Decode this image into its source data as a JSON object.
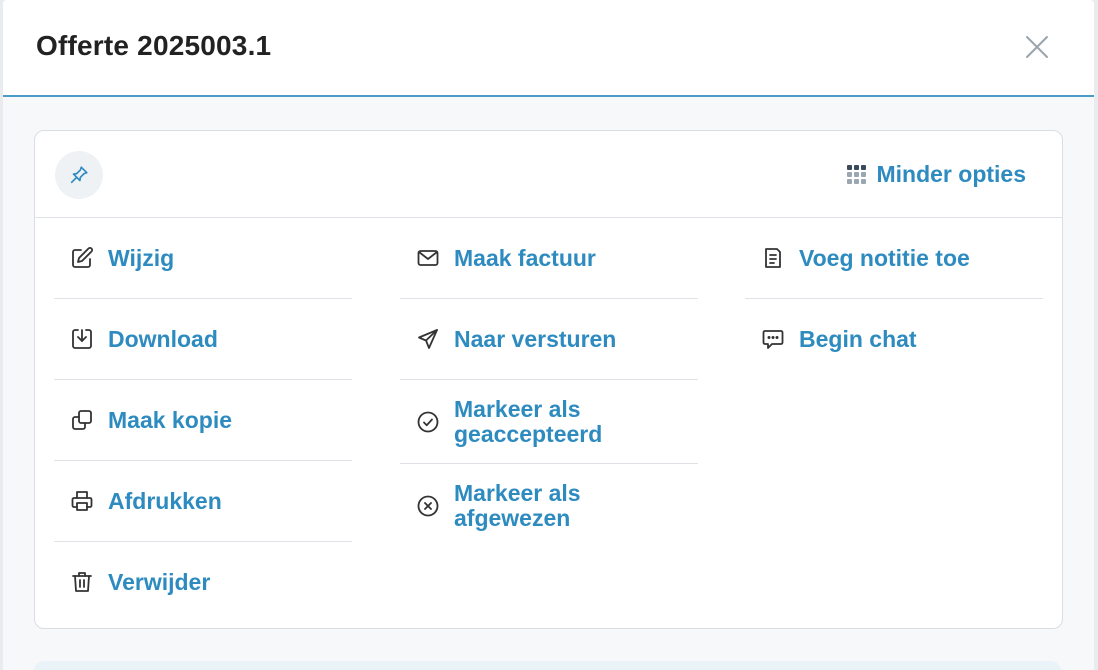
{
  "modal": {
    "title": "Offerte 2025003.1",
    "close_icon": "close-icon"
  },
  "toolbar": {
    "pin_icon": "pin-icon",
    "less_options_label": "Minder opties",
    "accent_color": "#2e8bc0"
  },
  "actions": {
    "col1": [
      {
        "label": "Wijzig",
        "icon": "edit-icon"
      },
      {
        "label": "Download",
        "icon": "download-icon"
      },
      {
        "label": "Maak kopie",
        "icon": "copy-icon"
      },
      {
        "label": "Afdrukken",
        "icon": "printer-icon"
      },
      {
        "label": "Verwijder",
        "icon": "trash-icon"
      }
    ],
    "col2": [
      {
        "label": "Maak factuur",
        "icon": "mail-icon"
      },
      {
        "label": "Naar versturen",
        "icon": "send-icon"
      },
      {
        "label": "Markeer als geaccepteerd",
        "icon": "check-circle-icon"
      },
      {
        "label": "Markeer als afgewezen",
        "icon": "x-circle-icon"
      }
    ],
    "col3": [
      {
        "label": "Voeg notitie toe",
        "icon": "note-icon"
      },
      {
        "label": "Begin chat",
        "icon": "chat-icon"
      }
    ]
  }
}
